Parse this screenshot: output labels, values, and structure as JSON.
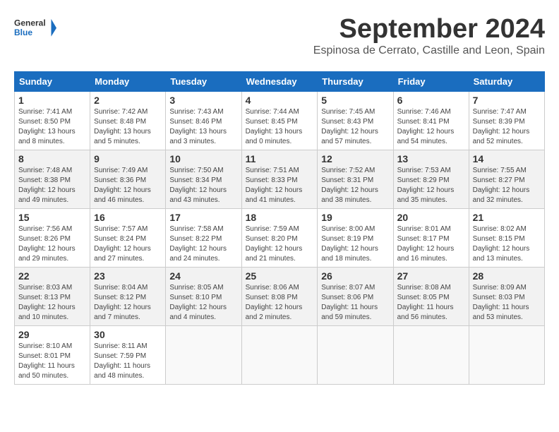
{
  "logo": {
    "general": "General",
    "blue": "Blue"
  },
  "title": "September 2024",
  "location": "Espinosa de Cerrato, Castille and Leon, Spain",
  "headers": [
    "Sunday",
    "Monday",
    "Tuesday",
    "Wednesday",
    "Thursday",
    "Friday",
    "Saturday"
  ],
  "weeks": [
    [
      {
        "day": "1",
        "sunrise": "7:41 AM",
        "sunset": "8:50 PM",
        "daylight": "13 hours and 8 minutes."
      },
      {
        "day": "2",
        "sunrise": "7:42 AM",
        "sunset": "8:48 PM",
        "daylight": "13 hours and 5 minutes."
      },
      {
        "day": "3",
        "sunrise": "7:43 AM",
        "sunset": "8:46 PM",
        "daylight": "13 hours and 3 minutes."
      },
      {
        "day": "4",
        "sunrise": "7:44 AM",
        "sunset": "8:45 PM",
        "daylight": "13 hours and 0 minutes."
      },
      {
        "day": "5",
        "sunrise": "7:45 AM",
        "sunset": "8:43 PM",
        "daylight": "12 hours and 57 minutes."
      },
      {
        "day": "6",
        "sunrise": "7:46 AM",
        "sunset": "8:41 PM",
        "daylight": "12 hours and 54 minutes."
      },
      {
        "day": "7",
        "sunrise": "7:47 AM",
        "sunset": "8:39 PM",
        "daylight": "12 hours and 52 minutes."
      }
    ],
    [
      {
        "day": "8",
        "sunrise": "7:48 AM",
        "sunset": "8:38 PM",
        "daylight": "12 hours and 49 minutes."
      },
      {
        "day": "9",
        "sunrise": "7:49 AM",
        "sunset": "8:36 PM",
        "daylight": "12 hours and 46 minutes."
      },
      {
        "day": "10",
        "sunrise": "7:50 AM",
        "sunset": "8:34 PM",
        "daylight": "12 hours and 43 minutes."
      },
      {
        "day": "11",
        "sunrise": "7:51 AM",
        "sunset": "8:33 PM",
        "daylight": "12 hours and 41 minutes."
      },
      {
        "day": "12",
        "sunrise": "7:52 AM",
        "sunset": "8:31 PM",
        "daylight": "12 hours and 38 minutes."
      },
      {
        "day": "13",
        "sunrise": "7:53 AM",
        "sunset": "8:29 PM",
        "daylight": "12 hours and 35 minutes."
      },
      {
        "day": "14",
        "sunrise": "7:55 AM",
        "sunset": "8:27 PM",
        "daylight": "12 hours and 32 minutes."
      }
    ],
    [
      {
        "day": "15",
        "sunrise": "7:56 AM",
        "sunset": "8:26 PM",
        "daylight": "12 hours and 29 minutes."
      },
      {
        "day": "16",
        "sunrise": "7:57 AM",
        "sunset": "8:24 PM",
        "daylight": "12 hours and 27 minutes."
      },
      {
        "day": "17",
        "sunrise": "7:58 AM",
        "sunset": "8:22 PM",
        "daylight": "12 hours and 24 minutes."
      },
      {
        "day": "18",
        "sunrise": "7:59 AM",
        "sunset": "8:20 PM",
        "daylight": "12 hours and 21 minutes."
      },
      {
        "day": "19",
        "sunrise": "8:00 AM",
        "sunset": "8:19 PM",
        "daylight": "12 hours and 18 minutes."
      },
      {
        "day": "20",
        "sunrise": "8:01 AM",
        "sunset": "8:17 PM",
        "daylight": "12 hours and 16 minutes."
      },
      {
        "day": "21",
        "sunrise": "8:02 AM",
        "sunset": "8:15 PM",
        "daylight": "12 hours and 13 minutes."
      }
    ],
    [
      {
        "day": "22",
        "sunrise": "8:03 AM",
        "sunset": "8:13 PM",
        "daylight": "12 hours and 10 minutes."
      },
      {
        "day": "23",
        "sunrise": "8:04 AM",
        "sunset": "8:12 PM",
        "daylight": "12 hours and 7 minutes."
      },
      {
        "day": "24",
        "sunrise": "8:05 AM",
        "sunset": "8:10 PM",
        "daylight": "12 hours and 4 minutes."
      },
      {
        "day": "25",
        "sunrise": "8:06 AM",
        "sunset": "8:08 PM",
        "daylight": "12 hours and 2 minutes."
      },
      {
        "day": "26",
        "sunrise": "8:07 AM",
        "sunset": "8:06 PM",
        "daylight": "11 hours and 59 minutes."
      },
      {
        "day": "27",
        "sunrise": "8:08 AM",
        "sunset": "8:05 PM",
        "daylight": "11 hours and 56 minutes."
      },
      {
        "day": "28",
        "sunrise": "8:09 AM",
        "sunset": "8:03 PM",
        "daylight": "11 hours and 53 minutes."
      }
    ],
    [
      {
        "day": "29",
        "sunrise": "8:10 AM",
        "sunset": "8:01 PM",
        "daylight": "11 hours and 50 minutes."
      },
      {
        "day": "30",
        "sunrise": "8:11 AM",
        "sunset": "7:59 PM",
        "daylight": "11 hours and 48 minutes."
      },
      null,
      null,
      null,
      null,
      null
    ]
  ],
  "labels": {
    "sunrise": "Sunrise:",
    "sunset": "Sunset:",
    "daylight": "Daylight:"
  }
}
